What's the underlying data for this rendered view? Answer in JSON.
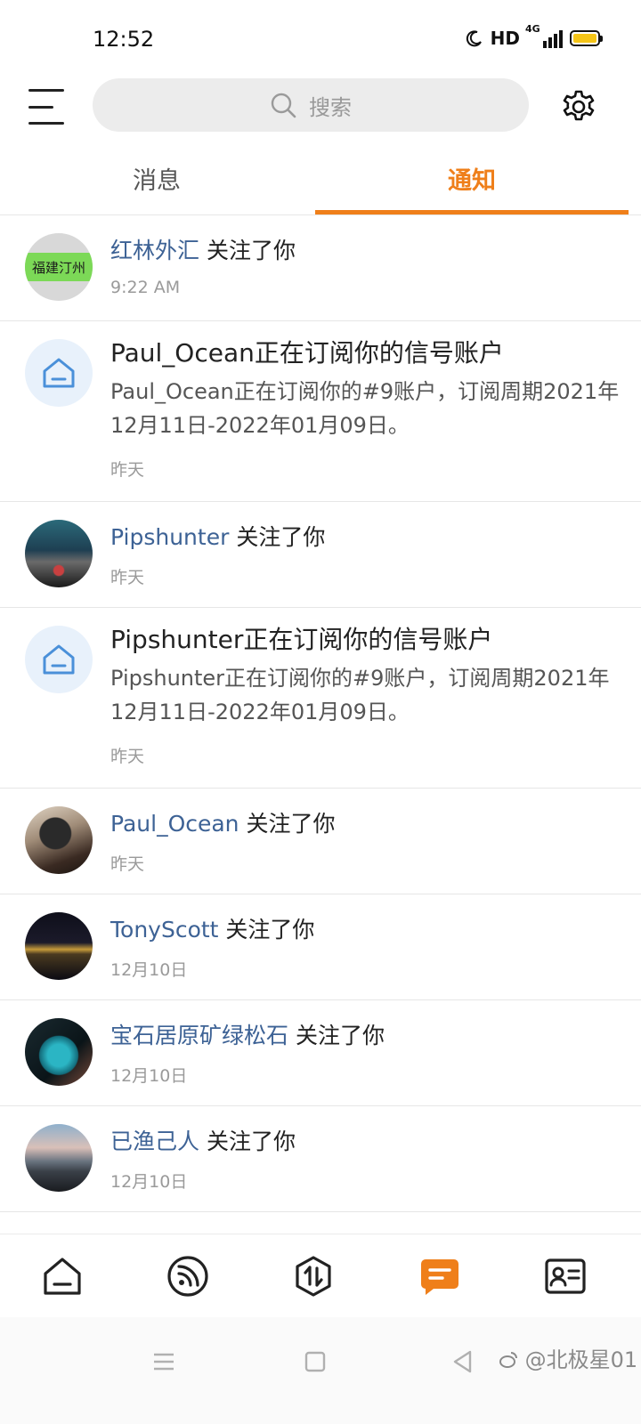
{
  "status_bar": {
    "time": "12:52",
    "hd_label": "HD",
    "network_label": "4G"
  },
  "header": {
    "search_placeholder": "搜索"
  },
  "tabs": [
    {
      "label": "消息",
      "active": false
    },
    {
      "label": "通知",
      "active": true
    }
  ],
  "colors": {
    "accent": "#ef7f1a",
    "link": "#3d6295",
    "battery": "#f5c518"
  },
  "notifications": [
    {
      "type": "follow",
      "avatar": "logo-avatar",
      "avatar_text": "福建汀州",
      "user": "红林外汇",
      "action": " 关注了你",
      "time": "9:22 AM"
    },
    {
      "type": "subscription",
      "avatar": "home-icon",
      "title": "Paul_Ocean正在订阅你的信号账户",
      "body": "Paul_Ocean正在订阅你的#9账户，订阅周期2021年12月11日-2022年01月09日。",
      "time": "昨天"
    },
    {
      "type": "follow",
      "avatar": "photo-avatar",
      "user": "Pipshunter",
      "action": " 关注了你",
      "time": "昨天"
    },
    {
      "type": "subscription",
      "avatar": "home-icon",
      "title": "Pipshunter正在订阅你的信号账户",
      "body": "Pipshunter正在订阅你的#9账户，订阅周期2021年12月11日-2022年01月09日。",
      "time": "昨天"
    },
    {
      "type": "follow",
      "avatar": "photo-avatar",
      "user": "Paul_Ocean",
      "action": " 关注了你",
      "time": "昨天"
    },
    {
      "type": "follow",
      "avatar": "photo-avatar",
      "user": "TonyScott",
      "action": " 关注了你",
      "time": "12月10日"
    },
    {
      "type": "follow",
      "avatar": "photo-avatar",
      "user": "宝石居原矿绿松石",
      "action": " 关注了你",
      "time": "12月10日"
    },
    {
      "type": "follow",
      "avatar": "photo-avatar",
      "user": "已渔己人",
      "action": " 关注了你",
      "time": "12月10日"
    }
  ],
  "bottom_nav": [
    {
      "icon": "home-icon",
      "active": false
    },
    {
      "icon": "rss-icon",
      "active": false
    },
    {
      "icon": "trade-icon",
      "active": false
    },
    {
      "icon": "message-icon",
      "active": true
    },
    {
      "icon": "contact-card-icon",
      "active": false
    }
  ],
  "system_nav": {
    "watermark": "@北极星01"
  }
}
